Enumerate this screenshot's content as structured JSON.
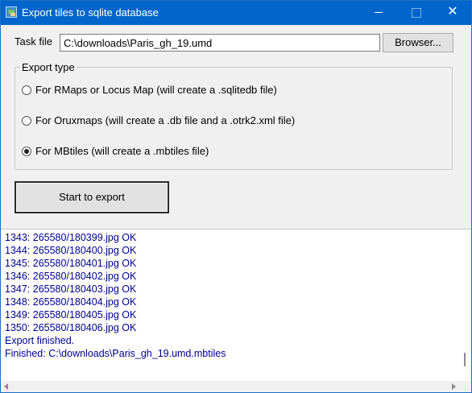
{
  "window": {
    "title": "Export tiles to sqlite database",
    "minimize_glyph": "",
    "maximize_glyph": "",
    "close_glyph": "✕"
  },
  "task_file": {
    "label": "Task file",
    "value": "C:\\downloads\\Paris_gh_19.umd",
    "browse_label": "Browser..."
  },
  "export_type": {
    "legend": "Export type",
    "options": [
      {
        "label": "For RMaps or Locus Map   (will create a .sqlitedb file)",
        "selected": false
      },
      {
        "label": "For Oruxmaps   (will create a .db file and a .otrk2.xml file)",
        "selected": false
      },
      {
        "label": "For MBtiles   (will create a .mbtiles file)",
        "selected": true
      }
    ]
  },
  "start_button": {
    "label": "Start to export"
  },
  "log": {
    "lines": [
      "1343: 265580/180399.jpg OK",
      "1344: 265580/180400.jpg OK",
      "1345: 265580/180401.jpg OK",
      "1346: 265580/180402.jpg OK",
      "1347: 265580/180403.jpg OK",
      "1348: 265580/180404.jpg OK",
      "1349: 265580/180405.jpg OK",
      "1350: 265580/180406.jpg OK",
      "Export finished.",
      "Finished: C:\\downloads\\Paris_gh_19.umd.mbtiles"
    ],
    "text_color": "#000090"
  },
  "colors": {
    "titlebar": "#0066cc",
    "window_bg": "#f0f0f0"
  }
}
